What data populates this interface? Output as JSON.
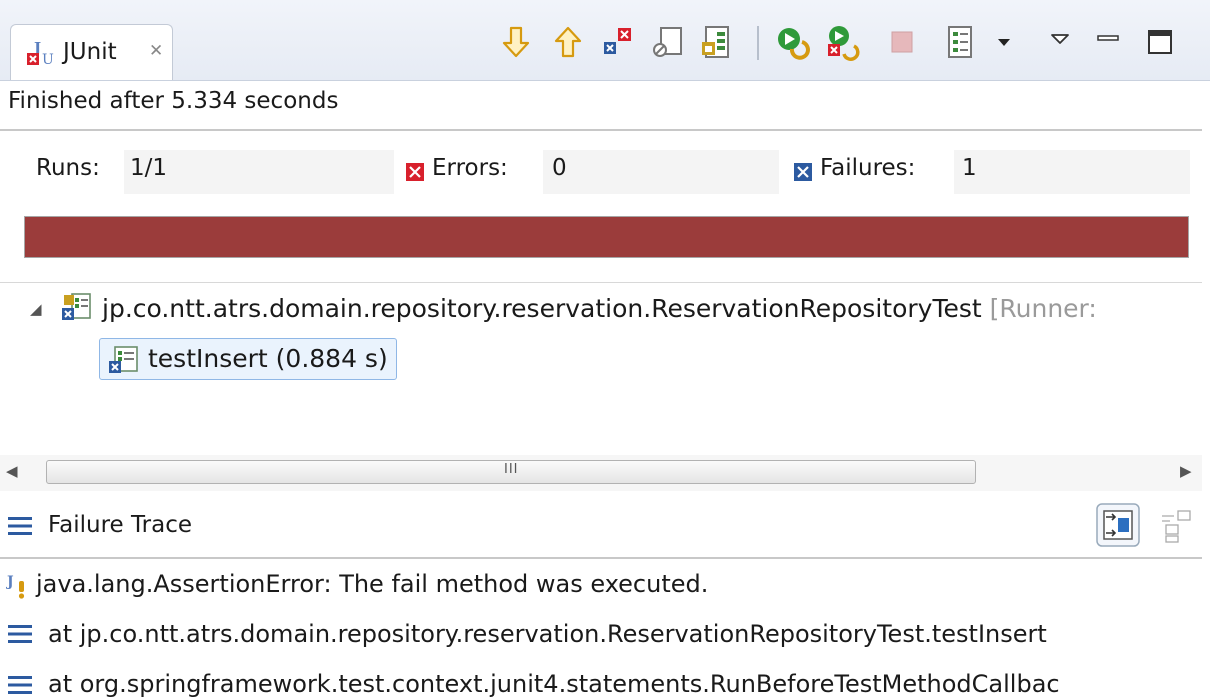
{
  "view": {
    "tab_label": "JUnit",
    "close_glyph": "✕",
    "toolbar": [
      {
        "name": "next-failure-icon"
      },
      {
        "name": "previous-failure-icon"
      },
      {
        "name": "show-failures-only-icon"
      },
      {
        "name": "scroll-lock-icon"
      },
      {
        "name": "test-run-session-icon"
      },
      {
        "name": "rerun-test-icon"
      },
      {
        "name": "rerun-failed-first-icon"
      },
      {
        "name": "stop-icon"
      },
      {
        "name": "test-run-history-icon"
      },
      {
        "name": "history-dropdown-icon"
      },
      {
        "name": "view-menu-icon"
      },
      {
        "name": "minimize-icon"
      },
      {
        "name": "maximize-icon"
      }
    ]
  },
  "status": "Finished after 5.334 seconds",
  "counters": {
    "runs_label": "Runs:",
    "runs_value": "1/1",
    "errors_label": "Errors:",
    "errors_value": "0",
    "failures_label": "Failures:",
    "failures_value": "1"
  },
  "progress": {
    "fraction": 1.0,
    "color": "#9b3c3b"
  },
  "tree": {
    "suite_label": "jp.co.ntt.atrs.domain.repository.reservation.ReservationRepositoryTest",
    "suite_runner": "[Runner:",
    "test_case": "testInsert (0.884 s)"
  },
  "scrollbar": {
    "grip": "III"
  },
  "failure_trace": {
    "title": "Failure Trace",
    "lines": [
      "java.lang.AssertionError: The fail method was executed.",
      "at jp.co.ntt.atrs.domain.repository.reservation.ReservationRepositoryTest.testInsert",
      "at org.springframework.test.context.junit4.statements.RunBeforeTestMethodCallbac"
    ]
  },
  "colors": {
    "failure_red": "#9b3c3b",
    "error_red": "#d8202c",
    "failure_blue": "#2c5aa0",
    "selection": "#eaf3fd"
  }
}
